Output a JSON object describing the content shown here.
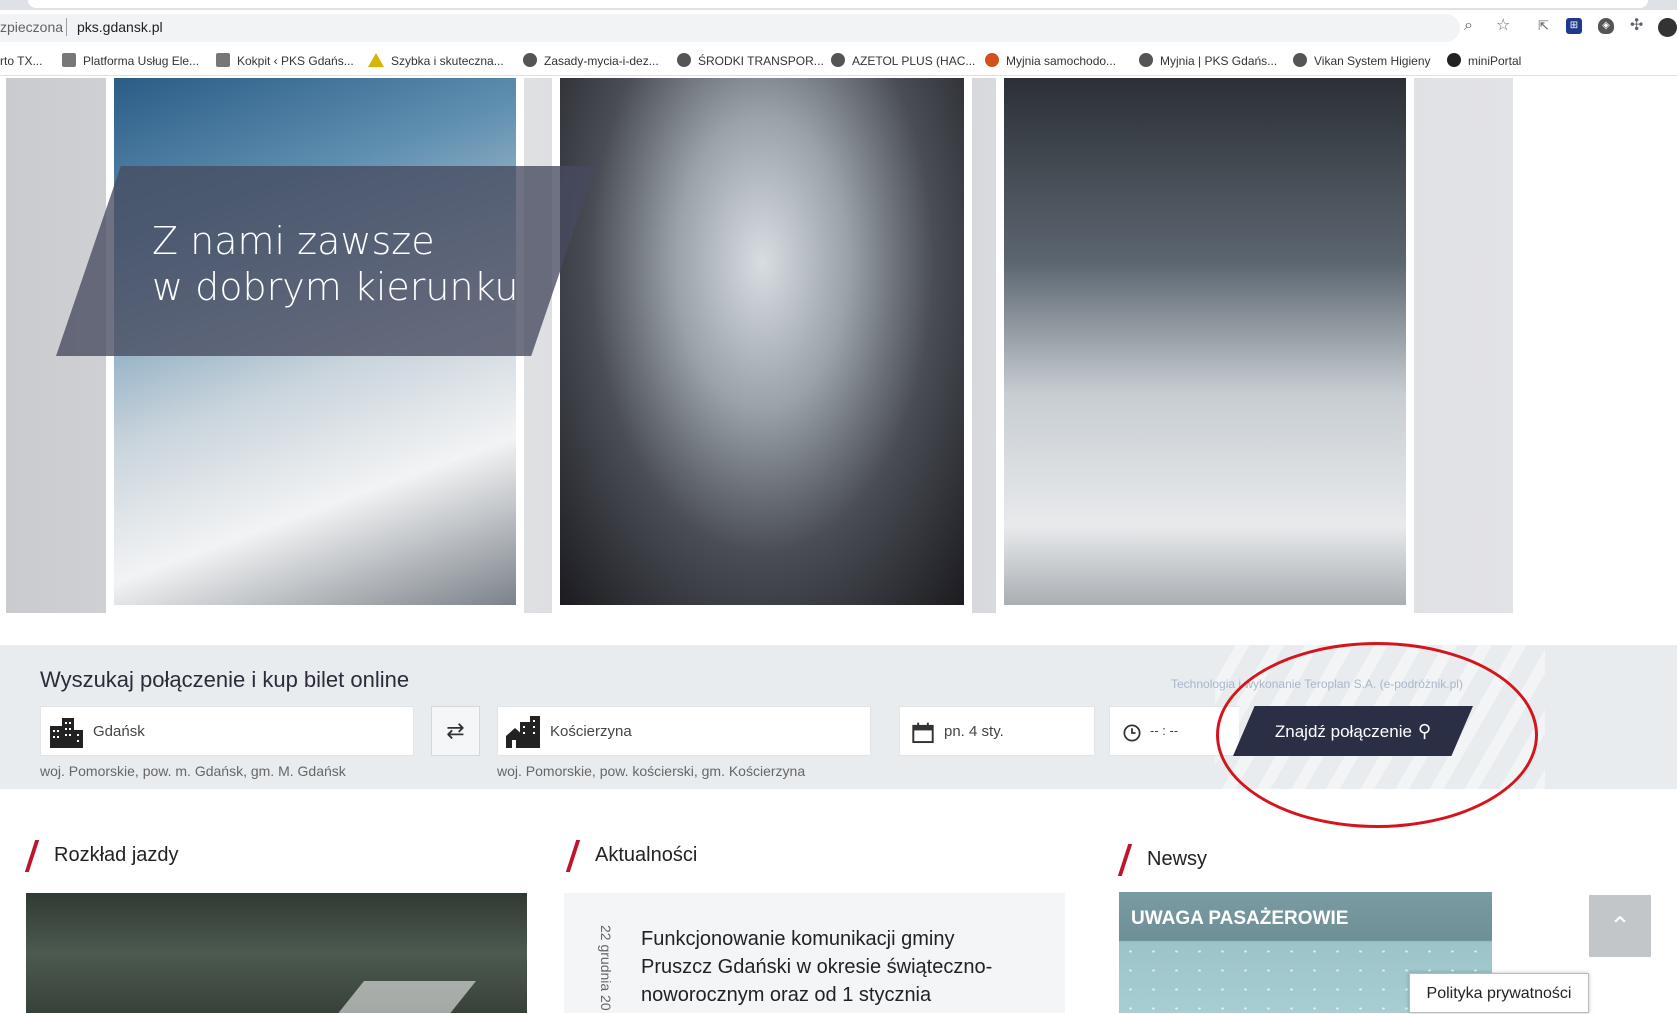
{
  "browser": {
    "security_label": "zpieczona",
    "url": "pks.gdansk.pl",
    "bookmarks": [
      {
        "label": "rto TX...",
        "icon": "globe-icon"
      },
      {
        "label": "Platforma Usług Ele...",
        "icon": "network-icon"
      },
      {
        "label": "Kokpit ‹ PKS Gdańs...",
        "icon": "pks-icon"
      },
      {
        "label": "Szybka i skuteczna...",
        "icon": "warning-icon"
      },
      {
        "label": "Zasady-mycia-i-dez...",
        "icon": "globe-icon"
      },
      {
        "label": "ŚRODKI TRANSPOR...",
        "icon": "globe-icon"
      },
      {
        "label": "AZETOL PLUS (HAC...",
        "icon": "globe-icon"
      },
      {
        "label": "Myjnia samochodo...",
        "icon": "car-wash-icon"
      },
      {
        "label": "Myjnia | PKS Gdańs...",
        "icon": "globe-icon"
      },
      {
        "label": "Vikan System Higieny",
        "icon": "globe-icon"
      },
      {
        "label": "miniPortal",
        "icon": "portal-icon"
      }
    ]
  },
  "hero": {
    "slogan": "Z nami zawsze\nw dobrym kierunku"
  },
  "search": {
    "title": "Wyszukaj połączenie i kup bilet online",
    "tech_credit": "Technologia i wykonanie Teroplan S.A. (e-podróżnik.pl)",
    "from_value": "Gdańsk",
    "from_region": "woj. Pomorskie, pow. m. Gdańsk, gm. M. Gdańsk",
    "to_value": "Kościerzyna",
    "to_region": "woj. Pomorskie, pow. kościerski, gm. Kościerzyna",
    "date_value": "pn. 4 sty.",
    "time_value": "-- : --",
    "swap_symbol": "⇄",
    "find_label": "Znajdź połączenie"
  },
  "sections": {
    "schedule_title": "Rozkład jazdy",
    "news_title": "Aktualności",
    "newsy_title": "Newsy",
    "news_date": "22 grudnia 20",
    "news_headline": "Funkcjonowanie komunikacji gminy Pruszcz Gdański w okresie świąteczno-noworocznym oraz od 1 stycznia",
    "alert_title": "UWAGA PASAŻEROWIE"
  },
  "footer": {
    "to_top_symbol": "⌃",
    "privacy_label": "Polityka prywatności"
  },
  "colors": {
    "accent_red": "#c0142a",
    "button_navy": "#2b2f45",
    "annotation_red": "#d4161c"
  }
}
